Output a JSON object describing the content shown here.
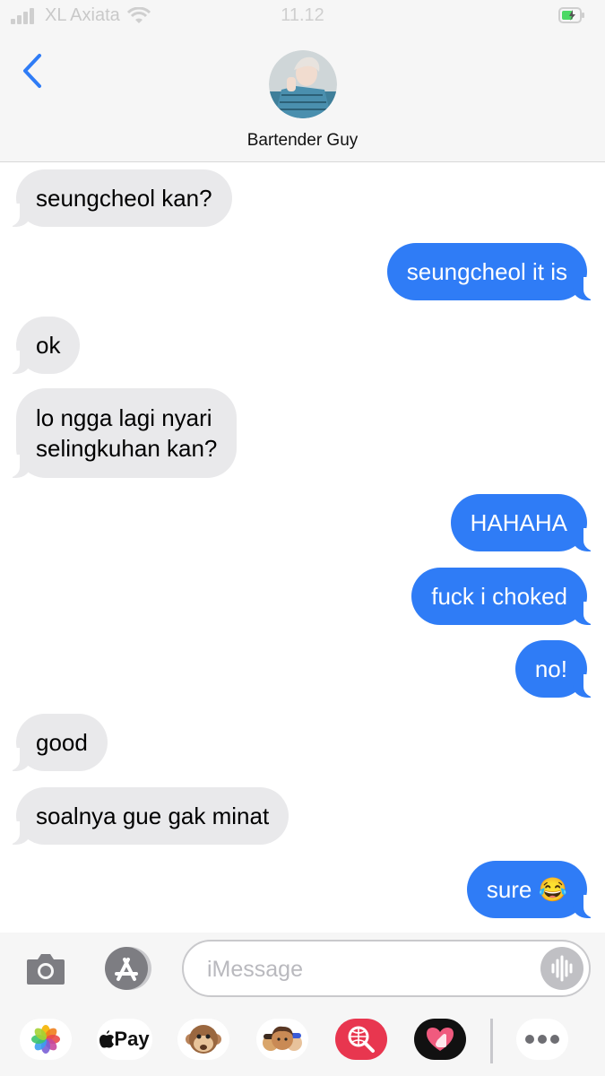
{
  "status_bar": {
    "carrier": "XL Axiata",
    "time": "11.12"
  },
  "header": {
    "contact_name": "Bartender Guy"
  },
  "messages": [
    {
      "direction": "incoming",
      "lines": [
        "seungcheol kan?"
      ]
    },
    {
      "direction": "outgoing",
      "lines": [
        "seungcheol it is"
      ]
    },
    {
      "direction": "incoming",
      "lines": [
        "ok"
      ]
    },
    {
      "direction": "incoming",
      "lines": [
        "lo ngga lagi nyari",
        "selingkuhan kan?"
      ]
    },
    {
      "direction": "outgoing",
      "lines": [
        "HAHAHA"
      ]
    },
    {
      "direction": "outgoing",
      "lines": [
        "fuck i choked"
      ]
    },
    {
      "direction": "outgoing",
      "lines": [
        "no!"
      ]
    },
    {
      "direction": "incoming",
      "lines": [
        "good"
      ]
    },
    {
      "direction": "incoming",
      "lines": [
        "soalnya gue gak minat"
      ]
    },
    {
      "direction": "outgoing",
      "lines": [
        "sure 😂"
      ]
    }
  ],
  "input": {
    "placeholder": "iMessage",
    "value": ""
  },
  "app_drawer": {
    "apple_pay_label": "Pay",
    "items": [
      "photos-app",
      "apple-pay-app",
      "animoji-monkey-app",
      "memoji-app",
      "web-search-app",
      "digital-touch-app",
      "more-apps"
    ]
  },
  "colors": {
    "outgoing_bubble": "#2f7cf6",
    "incoming_bubble": "#e9e9eb",
    "accent": "#2f7cf6"
  }
}
